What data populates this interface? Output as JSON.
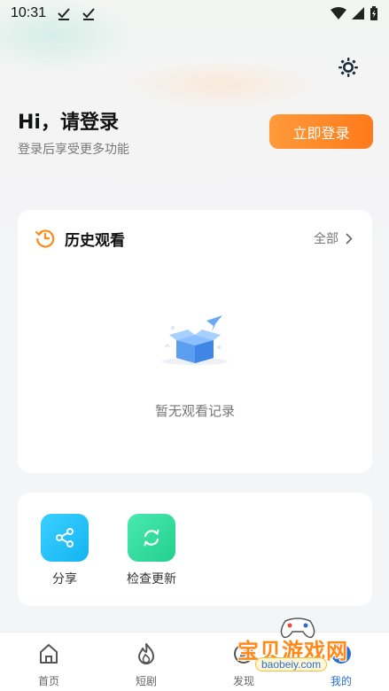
{
  "status_bar": {
    "time": "10:31"
  },
  "header": {
    "login_title": "Hi，请登录",
    "login_subtitle": "登录后享受更多功能",
    "login_button": "立即登录"
  },
  "history": {
    "title": "历史观看",
    "all_label": "全部",
    "empty_text": "暂无观看记录"
  },
  "tools": [
    {
      "label": "分享",
      "icon": "share-icon",
      "color": "#1ec3f5"
    },
    {
      "label": "检查更新",
      "icon": "refresh-icon",
      "color": "#2ee0a0"
    }
  ],
  "tab_bar": [
    {
      "label": "首页",
      "icon": "home-icon"
    },
    {
      "label": "短剧",
      "icon": "flame-icon"
    },
    {
      "label": "发现",
      "icon": "discover-icon"
    },
    {
      "label": "我的",
      "icon": "profile-icon",
      "active": true
    }
  ],
  "watermark": {
    "title": "宝贝游戏网",
    "url": "baobeiy.com"
  },
  "colors": {
    "accent": "#ff8a1a",
    "active_tab": "#2a6fd0"
  }
}
